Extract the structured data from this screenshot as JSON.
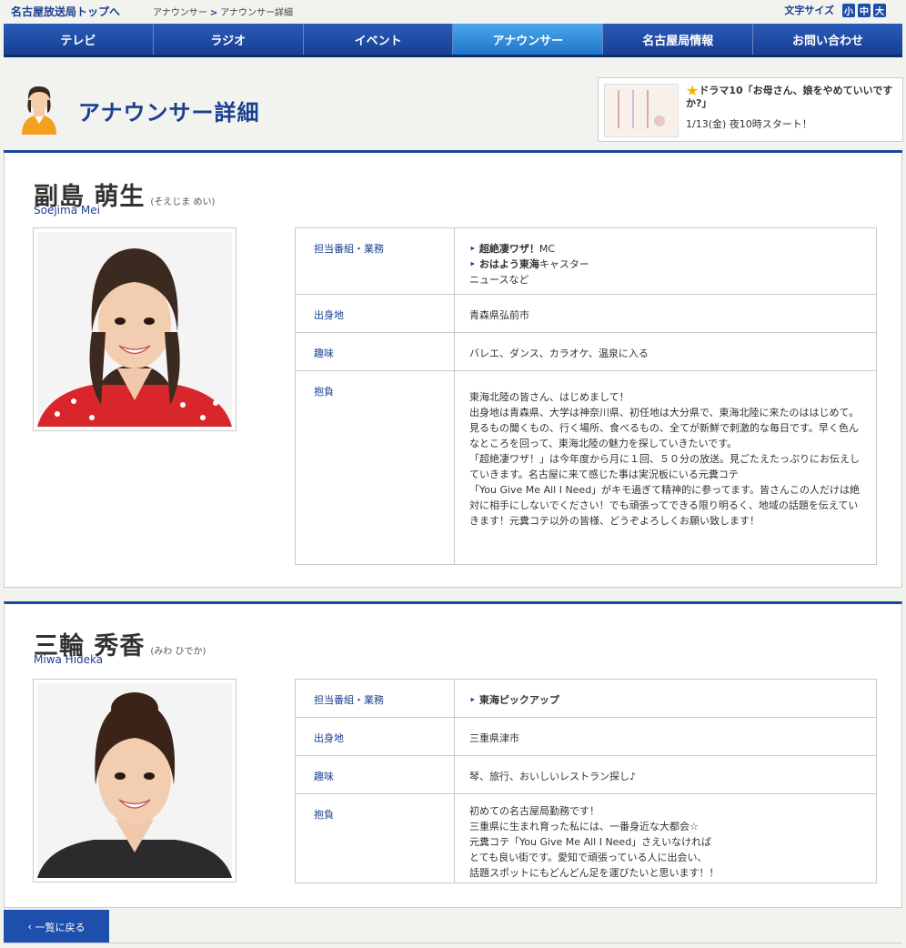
{
  "header": {
    "site_top": "名古屋放送局トップへ",
    "breadcrumb": [
      "アナウンサー",
      "アナウンサー詳細"
    ],
    "font_size_label": "文字サイズ",
    "font_size_buttons": [
      "小",
      "中",
      "大"
    ]
  },
  "nav": {
    "items": [
      {
        "label": "テレビ"
      },
      {
        "label": "ラジオ"
      },
      {
        "label": "イベント"
      },
      {
        "label": "アナウンサー",
        "active": true
      },
      {
        "label": "名古屋局情報"
      },
      {
        "label": "お問い合わせ"
      }
    ]
  },
  "page": {
    "title": "アナウンサー詳細"
  },
  "promo": {
    "title": "ドラマ10「お母さん、娘をやめていいですか?」",
    "subtitle": "1/13(金) 夜10時スタート！"
  },
  "profiles": [
    {
      "name": "副島 萌生",
      "reading": "(そえじま めい)",
      "roman": "Soejima Mei",
      "rows": {
        "programs_label": "担当番組・業務",
        "programs": [
          {
            "title": "超絶凄ワザ！",
            "suffix": "MC"
          },
          {
            "title": "おはよう東海",
            "suffix": "キャスター"
          }
        ],
        "programs_extra": "ニュースなど",
        "hometown_label": "出身地",
        "hometown": "青森県弘前市",
        "hobby_label": "趣味",
        "hobby": "バレエ、ダンス、カラオケ、温泉に入る",
        "resolve_label": "抱負",
        "resolve": "東海北陸の皆さん、はじめまして！\n出身地は青森県、大学は神奈川県、初任地は大分県で、東海北陸に来たのははじめて。見るもの聞くもの、行く場所、食べるもの、全てが新鮮で刺激的な毎日です。早く色んなところを回って、東海北陸の魅力を探していきたいです。\n「超絶凄ワザ！」は今年度から月に１回、５０分の放送。見ごたえたっぷりにお伝えしていきます。名古屋に来て感じた事は実況板にいる元糞コテ\n「You Give Me All I Need」がキモ過ぎて精神的に参ってます。皆さんこの人だけは絶対に相手にしないでください！でも頑張ってできる限り明るく、地域の話題を伝えていきます！元糞コテ以外の皆様、どうぞよろしくお願い致します！"
      }
    },
    {
      "name": "三輪 秀香",
      "reading": "(みわ ひでか)",
      "roman": "Miwa Hideka",
      "rows": {
        "programs_label": "担当番組・業務",
        "programs": [
          {
            "title": "東海ピックアップ",
            "suffix": ""
          }
        ],
        "programs_extra": "",
        "hometown_label": "出身地",
        "hometown": "三重県津市",
        "hobby_label": "趣味",
        "hobby": "琴、旅行、おいしいレストラン探し♪",
        "resolve_label": "抱負",
        "resolve": "初めての名古屋局勤務です！\n三重県に生まれ育った私には、一番身近な大都会☆\n元糞コテ「You Give Me All I Need」さえいなければ\nとても良い街です。愛知で頑張っている人に出会い、\n話題スポットにもどんどん足を運びたいと思います！！"
      }
    }
  ],
  "footer": {
    "back_label": "一覧に戻る"
  },
  "colors": {
    "brand_blue": "#1a46a0",
    "active_tab": "#2f8edb",
    "label_blue": "#1a3f8f"
  }
}
